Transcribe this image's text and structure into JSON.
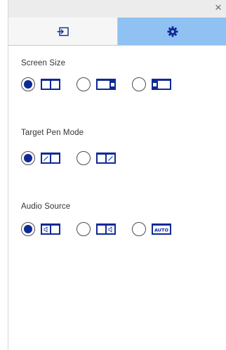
{
  "window": {
    "close_glyph": "×"
  },
  "tabs": [
    {
      "icon": "input-source-icon",
      "active": false
    },
    {
      "icon": "gear-icon",
      "active": true
    }
  ],
  "sections": [
    {
      "title": "Screen Size",
      "options": [
        {
          "icon": "screen-split-equal-icon",
          "selected": true
        },
        {
          "icon": "screen-split-right-small-icon",
          "selected": false
        },
        {
          "icon": "screen-split-left-small-icon",
          "selected": false
        }
      ]
    },
    {
      "title": "Target Pen Mode",
      "options": [
        {
          "icon": "pen-left-screen-icon",
          "selected": true
        },
        {
          "icon": "pen-right-screen-icon",
          "selected": false
        }
      ]
    },
    {
      "title": "Audio Source",
      "options": [
        {
          "icon": "audio-left-screen-icon",
          "selected": true
        },
        {
          "icon": "audio-right-screen-icon",
          "selected": false
        },
        {
          "icon": "audio-auto-icon",
          "label": "AUTO",
          "selected": false
        }
      ]
    }
  ],
  "colors": {
    "accent": "#0f2a96",
    "tab_active": "#8fc1f3",
    "titlebar": "#ececec"
  }
}
